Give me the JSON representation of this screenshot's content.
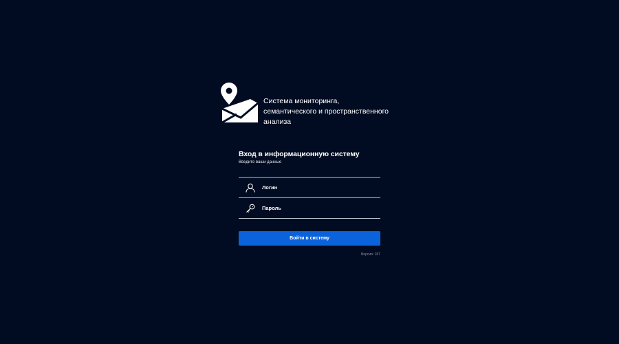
{
  "brand": {
    "logo_icon": "map-pin-envelope-icon",
    "title": "Система мониторинга, семантического и пространственного анализа"
  },
  "login": {
    "title": "Вход в информационную систему",
    "subtitle": "Введите ваши данные",
    "login_field": {
      "icon": "user-icon",
      "placeholder": "Логин",
      "value": ""
    },
    "password_field": {
      "icon": "key-icon",
      "placeholder": "Пароль",
      "value": ""
    },
    "submit_label": "Войти в систему",
    "version": "Версия: 187"
  },
  "colors": {
    "background": "#010c22",
    "accent": "#0a63da",
    "divider": "#b9c0cc"
  }
}
